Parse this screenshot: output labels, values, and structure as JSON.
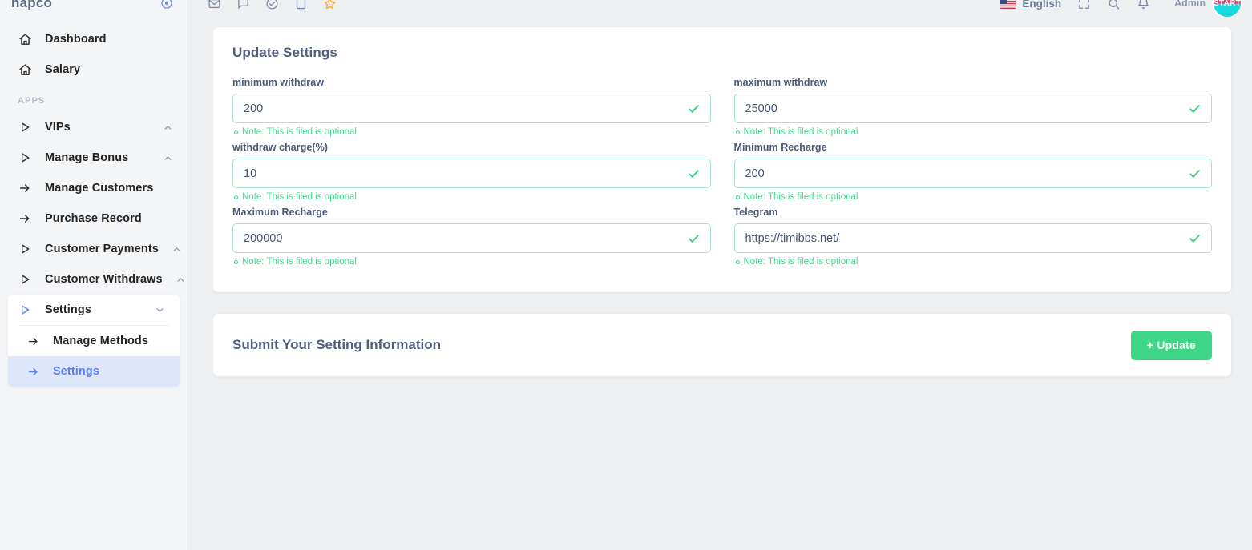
{
  "sidebar": {
    "brand": {
      "name": "napco",
      "icon": "target-icon"
    },
    "items": [
      {
        "label": "Dashboard",
        "icon": "home-icon",
        "type": "link"
      },
      {
        "label": "Salary",
        "icon": "home-icon",
        "type": "link"
      }
    ],
    "section_label": "APPS",
    "apps": [
      {
        "label": "VIPs",
        "icon": "play-triangle-icon",
        "caret": "chevron-up-icon",
        "type": "group"
      },
      {
        "label": "Manage Bonus",
        "icon": "play-triangle-icon",
        "caret": "chevron-up-icon",
        "type": "group"
      },
      {
        "label": "Manage Customers",
        "icon": "arrow-right-icon",
        "type": "link"
      },
      {
        "label": "Purchase Record",
        "icon": "arrow-right-icon",
        "type": "link"
      },
      {
        "label": "Customer Payments",
        "icon": "play-triangle-icon",
        "caret": "chevron-up-icon",
        "type": "group"
      },
      {
        "label": "Customer Withdraws",
        "icon": "play-triangle-icon",
        "caret": "chevron-up-icon",
        "type": "group"
      }
    ],
    "settings_group": {
      "label": "Settings",
      "icon": "play-triangle-icon",
      "caret": "chevron-down-icon",
      "children": [
        {
          "label": "Manage Methods",
          "icon": "arrow-right-icon",
          "active": false
        },
        {
          "label": "Settings",
          "icon": "arrow-right-icon",
          "active": true
        }
      ]
    }
  },
  "topbar": {
    "left_icons": [
      {
        "name": "mail-icon"
      },
      {
        "name": "chat-icon"
      },
      {
        "name": "check-circle-icon"
      },
      {
        "name": "note-icon"
      },
      {
        "name": "star-icon"
      }
    ],
    "language": {
      "label": "English",
      "flag": "us-flag-icon"
    },
    "right_icons": [
      {
        "name": "fullscreen-icon"
      },
      {
        "name": "search-icon"
      },
      {
        "name": "bell-icon"
      }
    ],
    "user": {
      "name": "",
      "role": "Admin",
      "avatar_text": "START"
    }
  },
  "main": {
    "settings_card": {
      "title": "Update Settings",
      "note_text": "Note: This is filed is optional",
      "fields": [
        {
          "label": "minimum withdraw",
          "value": "200",
          "placeholder": "minimum withdraw",
          "name": "minimum-withdraw"
        },
        {
          "label": "maximum withdraw",
          "value": "25000",
          "placeholder": "maximum withdraw",
          "name": "maximum-withdraw"
        },
        {
          "label": "withdraw charge(%)",
          "value": "10",
          "placeholder": "withdraw charge",
          "name": "withdraw-charge"
        },
        {
          "label": "Minimum Recharge",
          "value": "200",
          "placeholder": "Minimum Recharge",
          "name": "minimum-recharge"
        },
        {
          "label": "Maximum Recharge",
          "value": "200000",
          "placeholder": "Maximum Recharge",
          "name": "maximum-recharge"
        },
        {
          "label": "Telegram",
          "value": "https://timibbs.net/",
          "placeholder": "Telegram",
          "name": "telegram"
        }
      ]
    },
    "submit_card": {
      "title": "Submit Your Setting Information",
      "button_label": "+ Update"
    }
  },
  "colors": {
    "accent_green": "#3ed686",
    "input_border": "#a6e6c4",
    "note_green": "#46d68f",
    "title_slate": "#4f5d7e",
    "active_blue": "#5b7cf5",
    "active_bg": "#dde6fb",
    "star_orange": "#f5a93c",
    "page_bg": "#eef0f2"
  }
}
